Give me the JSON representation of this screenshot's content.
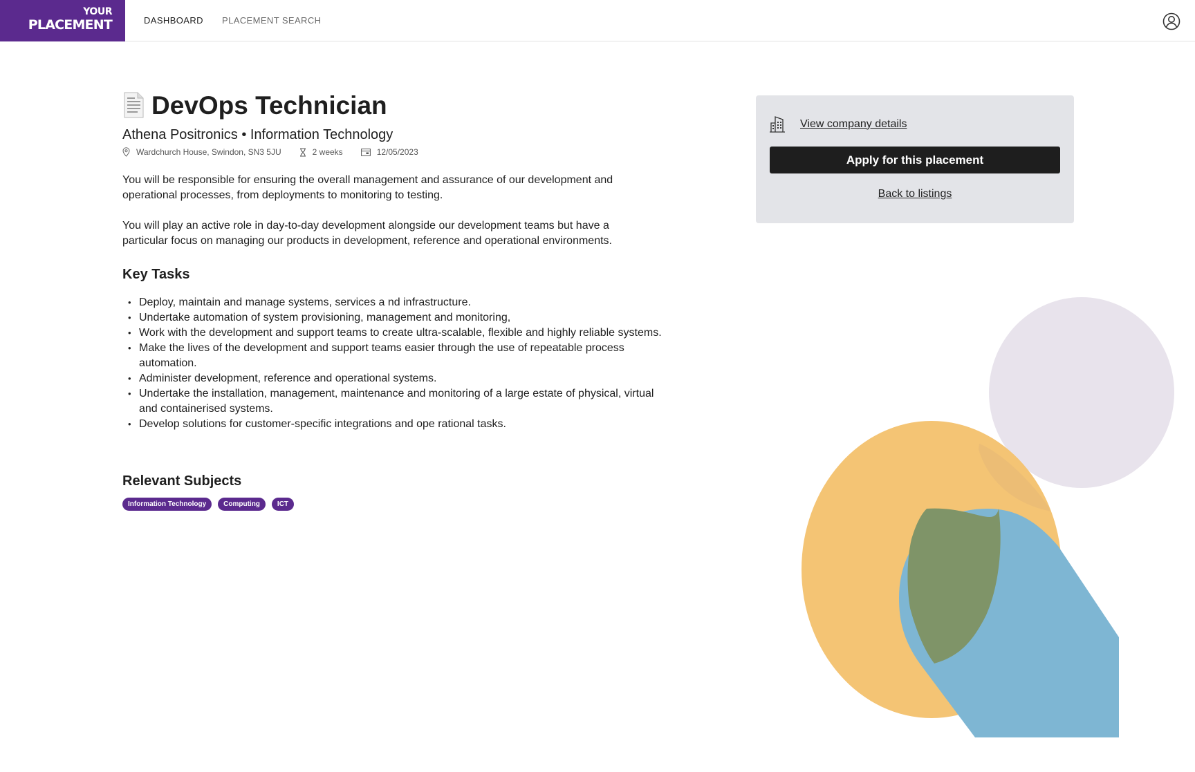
{
  "header": {
    "logo_top": "YOUR",
    "logo_main": "PLACEMENT",
    "nav": [
      {
        "label": "DASHBOARD",
        "active": true
      },
      {
        "label": "PLACEMENT SEARCH",
        "active": false
      }
    ],
    "account_icon": "user-circle-icon"
  },
  "placement": {
    "title": "DevOps Technician",
    "title_icon": "document-icon",
    "subtitle": "Athena Positronics • Information Technology",
    "location": "Wardchurch House, Swindon, SN3 5JU",
    "duration": "2 weeks",
    "start_date": "12/05/2023",
    "description": [
      "You will be responsible for ensuring the overall management and assurance of our development and operational processes, from deployments to monitoring to testing.",
      "You will play an active role in day-to-day development alongside our development teams but have a particular focus on managing our products in development, reference and operational environments."
    ],
    "key_tasks_heading": "Key Tasks",
    "key_tasks": [
      "Deploy, maintain and manage systems, services a nd infrastructure.",
      "Undertake automation of system provisioning, management and monitoring,",
      "Work with the development and support teams to create ultra-scalable, flexible and highly reliable systems.",
      "Make the lives of the development and support teams easier through the use of repeatable process automation.",
      "Administer development, reference and operational systems.",
      "Undertake the installation, management, maintenance and monitoring of a large estate of physical, virtual and containerised systems.",
      "Develop solutions for customer-specific integrations and ope   rational tasks."
    ],
    "subjects_heading": "Relevant Subjects",
    "subjects": [
      "Information Technology",
      "Computing",
      "ICT"
    ]
  },
  "panel": {
    "company_link": "View company details",
    "apply_label": "Apply for this placement",
    "back_link": "Back to listings"
  },
  "colors": {
    "brand_purple": "#5b2a8e",
    "panel_bg": "#e3e4e8",
    "button_bg": "#1e1e1e",
    "decor_orange": "#f4c474",
    "decor_blue": "#7eb6d3",
    "decor_lilac": "#e8e3ec",
    "decor_overlap": "#7f9468"
  }
}
